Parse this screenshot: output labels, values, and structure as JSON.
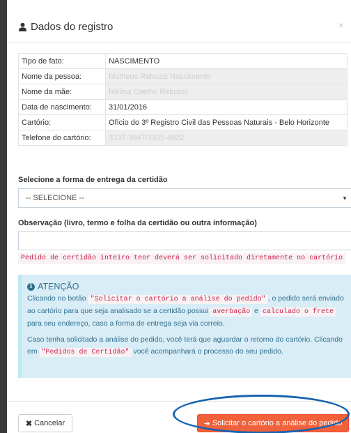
{
  "header": {
    "title": "Dados do registro",
    "close_label": "×"
  },
  "registro": {
    "rows": [
      {
        "label": "Tipo de fato:",
        "value": "NASCIMENTO"
      },
      {
        "label": "Nome da pessoa:",
        "value": "Matheus Rebuzzi Nascimento"
      },
      {
        "label": "Nome da mãe:",
        "value": "Melina Coelho Rebuzzi"
      },
      {
        "label": "Data de nascimento:",
        "value": "31/01/2016"
      },
      {
        "label": "Cartório:",
        "value": "Ofício do 3º Registro Civil das Pessoas Naturais - Belo Horizonte"
      },
      {
        "label": "Telefone do cartório:",
        "value": "3337-3947/3335-4822"
      }
    ]
  },
  "entrega": {
    "label": "Selecione a forma de entrega da certidão",
    "selected": "-- SELECIONE --"
  },
  "observacao": {
    "label": "Observação (livro, termo e folha da certidão ou outra informação)",
    "value": "",
    "note": "Pedido de certidão inteiro teor deverá ser solicitado diretamente no cartório"
  },
  "alert": {
    "title": "ATENÇÃO",
    "p1_a": "Clicando no botão ",
    "p1_code1": "\"Solicitar o cartório a análise do pedido\"",
    "p1_b": ", o pedido será enviado ao cartório para que seja analisado se a certidão possui ",
    "p1_code2": "averbação",
    "p1_c": " e ",
    "p1_code3": "calculado o frete",
    "p1_d": " para seu endereço, caso a forma de entrega seja via correio.",
    "p2_a": "Caso tenha solicitado a análise do pedido, você terá que aguardar o retorno do cartório. Clicando em ",
    "p2_code": "\"Pedidos de Certidão\"",
    "p2_b": " você acompanhará o processo do seu pedido."
  },
  "footer": {
    "cancel_label": "Cancelar",
    "submit_label": "Solicitar o cartório a análise do pedido"
  },
  "colors": {
    "submit_bg": "#f0613c",
    "alert_bg": "#d9edf7",
    "alert_text": "#31708f",
    "code_text": "#c7254e",
    "highlight": "#1664b0"
  }
}
